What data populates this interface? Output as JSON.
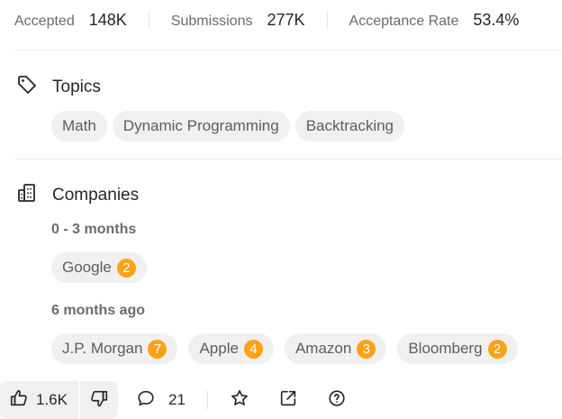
{
  "stats": [
    {
      "label": "Accepted",
      "value": "148K"
    },
    {
      "label": "Submissions",
      "value": "277K"
    },
    {
      "label": "Acceptance Rate",
      "value": "53.4%"
    }
  ],
  "topics": {
    "title": "Topics",
    "icon": "tag-icon",
    "tags": [
      "Math",
      "Dynamic Programming",
      "Backtracking"
    ]
  },
  "companies": {
    "title": "Companies",
    "icon": "building-icon",
    "groups": [
      {
        "period": "0 - 3 months",
        "items": [
          {
            "name": "Google",
            "count": "2"
          }
        ]
      },
      {
        "period": "6 months ago",
        "items": [
          {
            "name": "J.P. Morgan",
            "count": "7"
          },
          {
            "name": "Apple",
            "count": "4"
          },
          {
            "name": "Amazon",
            "count": "3"
          },
          {
            "name": "Bloomberg",
            "count": "2"
          }
        ]
      }
    ]
  },
  "actions": {
    "likes": "1.6K",
    "comments": "21",
    "icons": [
      "thumbs-up-icon",
      "thumbs-down-icon",
      "comment-icon",
      "star-icon",
      "share-icon",
      "help-icon"
    ]
  },
  "colors": {
    "accent": "#ffa116",
    "chip_bg": "#f0f0f0",
    "muted_text": "#6b6b6b"
  }
}
